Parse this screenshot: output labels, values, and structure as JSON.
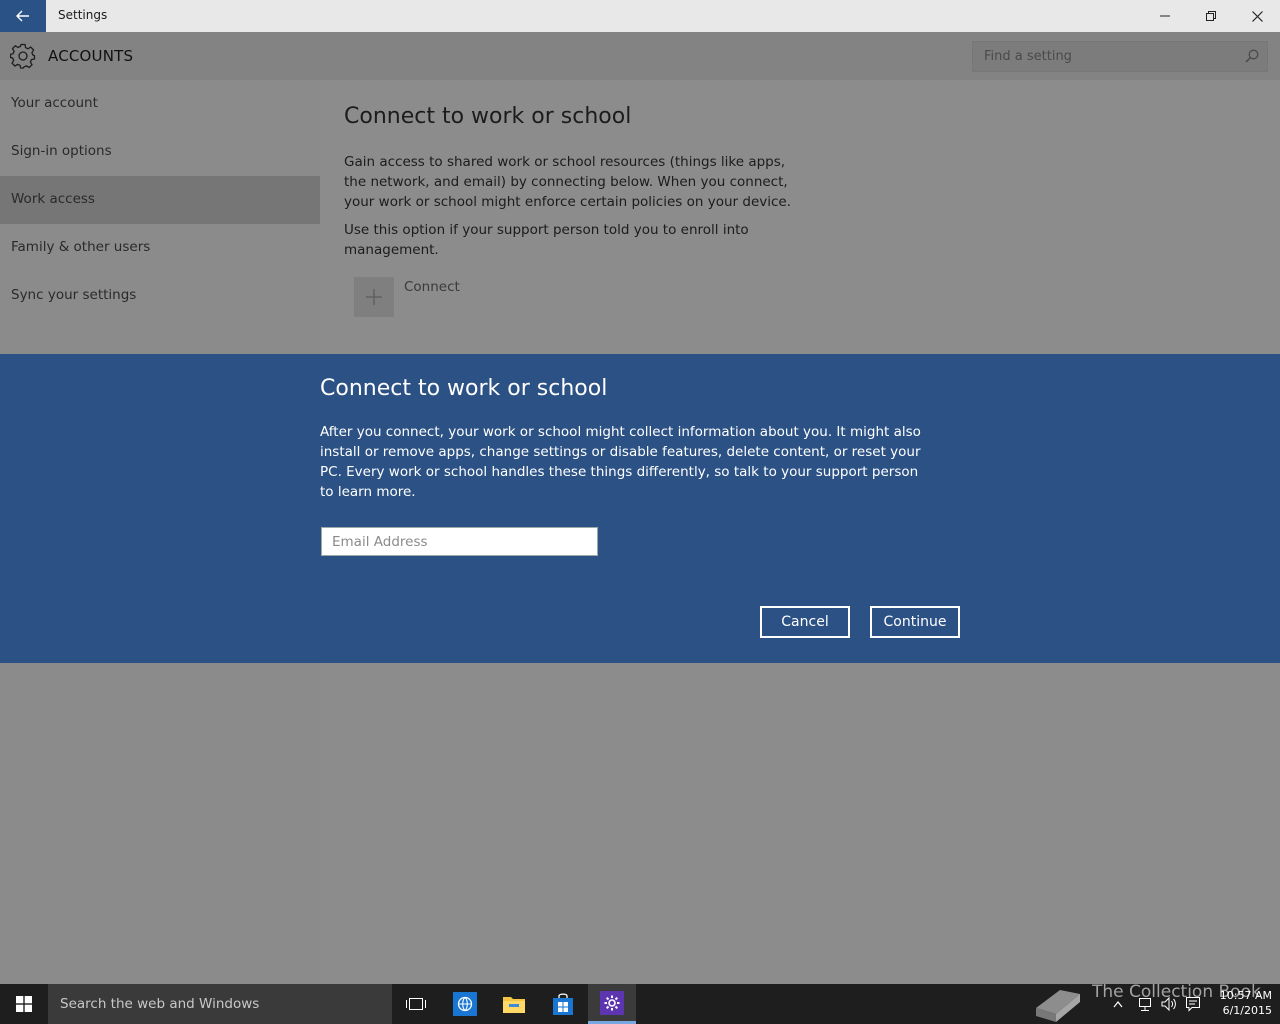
{
  "window": {
    "title": "Settings",
    "minimize_label": "Minimize",
    "restore_label": "Restore",
    "close_label": "Close"
  },
  "header": {
    "title": "ACCOUNTS",
    "search": {
      "placeholder": "Find a setting"
    }
  },
  "sidebar": {
    "items": [
      {
        "label": "Your account",
        "active": false
      },
      {
        "label": "Sign-in options",
        "active": false
      },
      {
        "label": "Work access",
        "active": true
      },
      {
        "label": "Family & other users",
        "active": false
      },
      {
        "label": "Sync your settings",
        "active": false
      }
    ]
  },
  "main": {
    "title": "Connect to work or school",
    "paragraph1": "Gain access to shared work or school resources (things like apps, the network, and email) by connecting below. When you connect, your work or school might enforce certain policies on your device.",
    "paragraph2": "Use this option if your support person told you to enroll into management.",
    "connect_label": "Connect"
  },
  "dialog": {
    "title": "Connect to work or school",
    "text": "After you connect, your work or school might collect information about you. It might also install or remove apps, change settings or disable features, delete content, or reset your PC. Every work or school handles these things differently, so talk to your support person to learn more.",
    "email": {
      "value": "",
      "placeholder": "Email Address"
    },
    "cancel_label": "Cancel",
    "continue_label": "Continue"
  },
  "taskbar": {
    "search_text": "Search the web and Windows",
    "watermark_text": "The Collection Book",
    "time": "10:57 AM",
    "date": "6/1/2015"
  },
  "colors": {
    "accent": "#2b5286",
    "dialog_bg": "#2c5285",
    "taskbar_bg": "#1e1e1e",
    "settings_icon": "#5e35b1"
  }
}
